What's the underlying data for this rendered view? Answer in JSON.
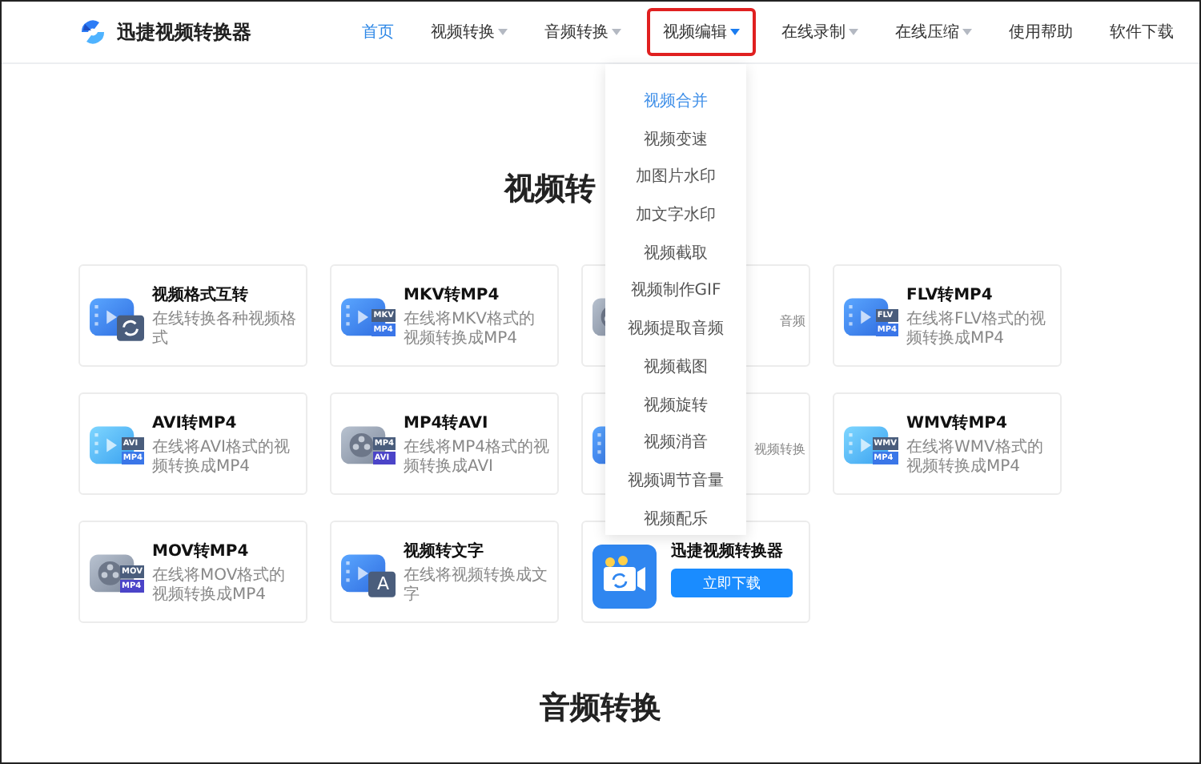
{
  "logo": {
    "text": "迅捷视频转换器"
  },
  "nav": [
    {
      "label": "首页",
      "selected": true,
      "caret": false,
      "highlighted": false
    },
    {
      "label": "视频转换",
      "selected": false,
      "caret": true,
      "highlighted": false
    },
    {
      "label": "音频转换",
      "selected": false,
      "caret": true,
      "highlighted": false
    },
    {
      "label": "视频编辑",
      "selected": false,
      "caret": true,
      "highlighted": true
    },
    {
      "label": "在线录制",
      "selected": false,
      "caret": true,
      "highlighted": false
    },
    {
      "label": "在线压缩",
      "selected": false,
      "caret": true,
      "highlighted": false
    },
    {
      "label": "使用帮助",
      "selected": false,
      "caret": false,
      "highlighted": false
    },
    {
      "label": "软件下载",
      "selected": false,
      "caret": false,
      "highlighted": false
    }
  ],
  "dropdown": {
    "items": [
      {
        "label": "视频合并",
        "selected": true
      },
      {
        "label": "视频变速",
        "selected": false
      },
      {
        "label": "加图片水印",
        "selected": false
      },
      {
        "label": "加文字水印",
        "selected": false
      },
      {
        "label": "视频截取",
        "selected": false
      },
      {
        "label": "视频制作GIF",
        "selected": false
      },
      {
        "label": "视频提取音频",
        "selected": false
      },
      {
        "label": "视频截图",
        "selected": false
      },
      {
        "label": "视频旋转",
        "selected": false
      },
      {
        "label": "视频消音",
        "selected": false
      },
      {
        "label": "视频调节音量",
        "selected": false
      },
      {
        "label": "视频配乐",
        "selected": false
      }
    ]
  },
  "sections": [
    {
      "heading": "视频转",
      "cards": [
        {
          "kind": "tool",
          "title": "视频格式互转",
          "desc": "在线转换各种视频格式",
          "icon": {
            "kind": "film",
            "overlay": {
              "kind": "sync"
            }
          }
        },
        {
          "kind": "tool",
          "title": "MKV转MP4",
          "desc": "在线将MKV格式的视频转换成MP4",
          "icon": {
            "kind": "film",
            "overlay": {
              "kind": "badges",
              "badges": [
                "MKV",
                "MP4"
              ]
            }
          }
        },
        {
          "kind": "covered",
          "desc": "音频",
          "icon": {
            "kind": "reel"
          }
        },
        {
          "kind": "tool",
          "title": "FLV转MP4",
          "desc": "在线将FLV格式的视频转换成MP4",
          "icon": {
            "kind": "film",
            "overlay": {
              "kind": "badges",
              "badges": [
                "FLV",
                "MP4"
              ]
            }
          }
        },
        {
          "kind": "tool",
          "title": "AVI转MP4",
          "desc": "在线将AVI格式的视频转换成MP4",
          "icon": {
            "kind": "film-light",
            "overlay": {
              "kind": "badges",
              "badges": [
                "AVI",
                "MP4"
              ]
            }
          }
        },
        {
          "kind": "tool",
          "title": "MP4转AVI",
          "desc": "在线将MP4格式的视频转换成AVI",
          "icon": {
            "kind": "reel",
            "overlay": {
              "kind": "badges",
              "badges": [
                "MP4",
                "AVI"
              ]
            }
          }
        },
        {
          "kind": "covered",
          "desc": "视频转换",
          "icon": {
            "kind": "film"
          }
        },
        {
          "kind": "tool",
          "title": "WMV转MP4",
          "desc": "在线将WMV格式的视频转换成MP4",
          "icon": {
            "kind": "film-light",
            "overlay": {
              "kind": "badges",
              "badges": [
                "WMV",
                "MP4"
              ]
            }
          }
        },
        {
          "kind": "tool",
          "title": "MOV转MP4",
          "desc": "在线将MOV格式的视频转换成MP4",
          "icon": {
            "kind": "reel",
            "overlay": {
              "kind": "badges",
              "badges": [
                "MOV",
                "MP4"
              ]
            }
          }
        },
        {
          "kind": "tool",
          "title": "视频转文字",
          "desc": "在线将视频转换成文字",
          "icon": {
            "kind": "film",
            "overlay": {
              "kind": "letter",
              "letter": "A"
            }
          }
        },
        {
          "kind": "download",
          "title": "迅捷视频转换器",
          "button": "立即下载"
        }
      ]
    },
    {
      "heading": "音频转换"
    }
  ]
}
